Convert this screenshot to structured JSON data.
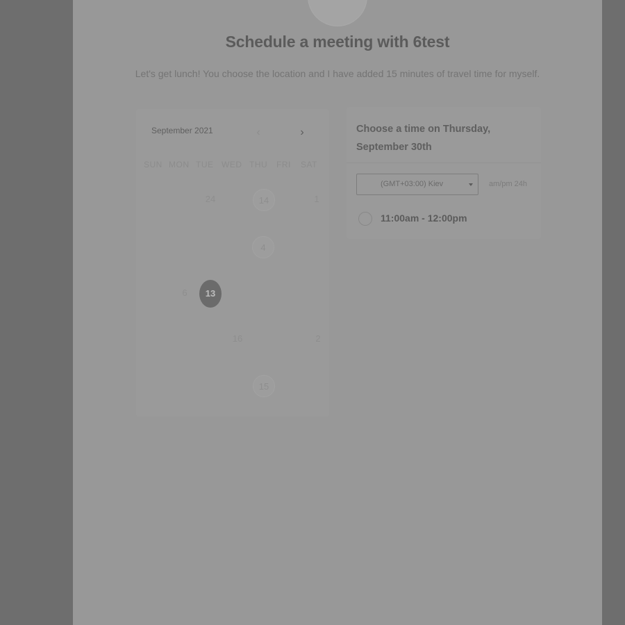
{
  "header": {
    "title": "Schedule a meeting with 6test",
    "subtitle": "Let's get lunch! You choose the location and I have added 15 minutes of travel time for myself."
  },
  "calendar": {
    "month": "September 2021",
    "prev_icon": "chevron-left-icon",
    "next_icon": "chevron-right-icon",
    "weekdays": [
      "SUN",
      "MON",
      "TUE",
      "WED",
      "THU",
      "FRI",
      "SAT"
    ],
    "days": [
      "24",
      "14",
      "1",
      "4",
      "6",
      "13",
      "16",
      "2",
      "15"
    ],
    "selected_day": "13"
  },
  "slots_panel": {
    "heading": "Choose a time on Thursday, September 30th",
    "timezone": "(GMT+03:00) Kiev",
    "format": "am/pm  24h",
    "slots": [
      "11:00am - 12:00pm"
    ]
  },
  "colors": {
    "overlay": "#6e6e6e",
    "panel": "#989898",
    "selected_day": "#6b6b6b"
  }
}
